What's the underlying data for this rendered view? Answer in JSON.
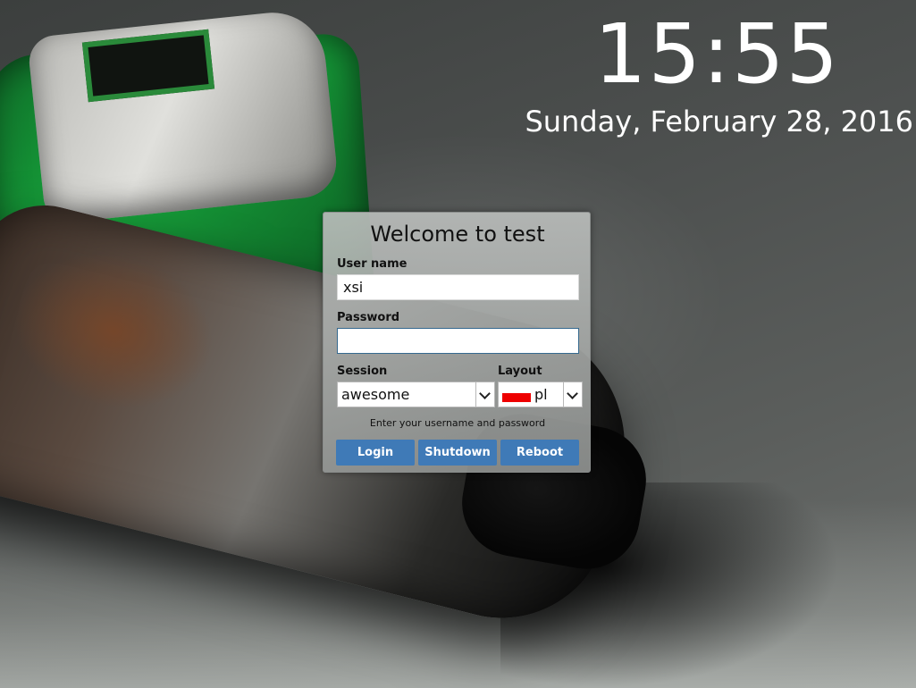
{
  "clock": {
    "time": "15:55",
    "date": "Sunday, February 28, 2016"
  },
  "login": {
    "welcome": "Welcome to test",
    "username_label": "User name",
    "username_value": "xsi",
    "password_label": "Password",
    "password_value": "",
    "session_label": "Session",
    "session_value": "awesome",
    "layout_label": "Layout",
    "layout_value": "pl",
    "layout_flag_color": "#ee0000",
    "hint": "Enter your username and password",
    "buttons": {
      "login": "Login",
      "shutdown": "Shutdown",
      "reboot": "Reboot"
    }
  },
  "colors": {
    "button_bg": "#3f7ab7",
    "focus_border": "#35698f"
  }
}
